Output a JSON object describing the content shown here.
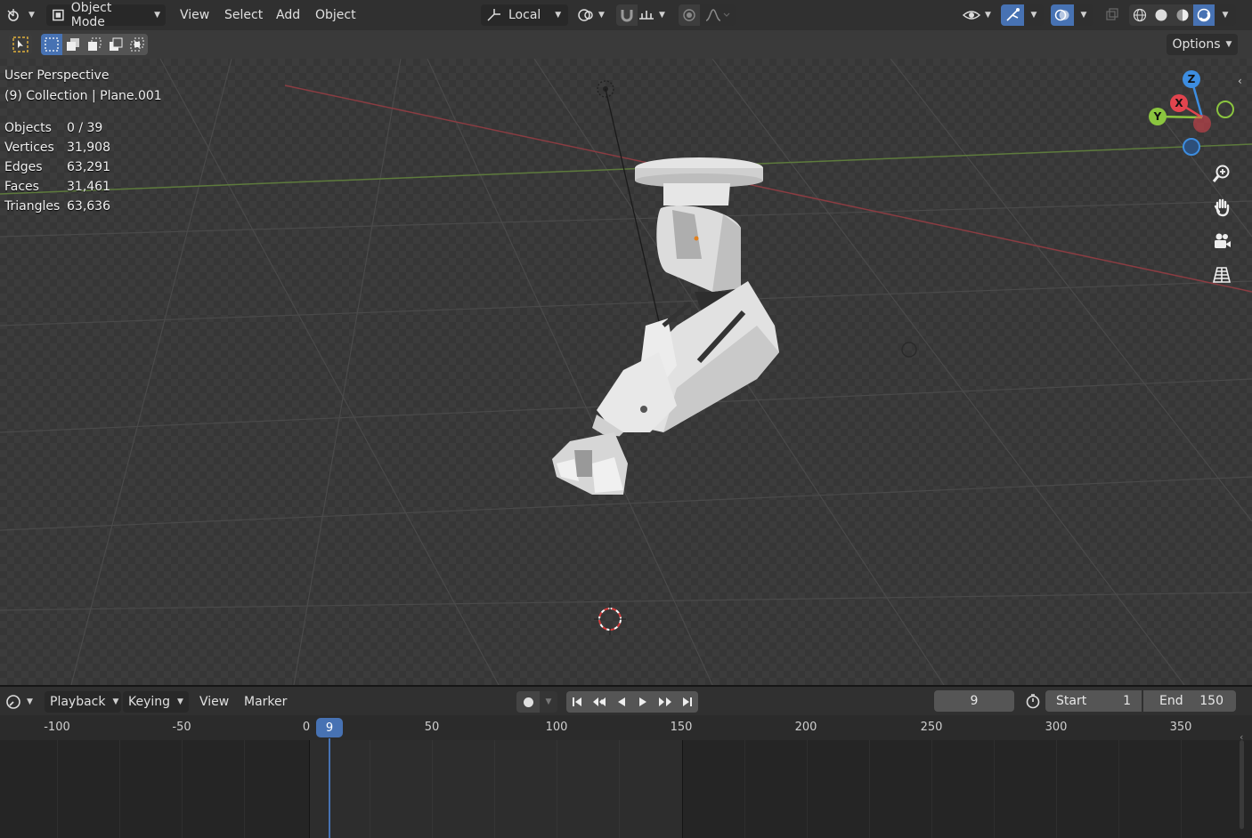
{
  "header": {
    "mode": "Object Mode",
    "menus": [
      "View",
      "Select",
      "Add",
      "Object"
    ],
    "orientation": "Local",
    "options": "Options"
  },
  "viewport": {
    "perspective_label": "User Perspective",
    "collection_label": "(9) Collection | Plane.001",
    "stats": [
      {
        "label": "Objects",
        "value": "0 / 39"
      },
      {
        "label": "Vertices",
        "value": "31,908"
      },
      {
        "label": "Edges",
        "value": "63,291"
      },
      {
        "label": "Faces",
        "value": "31,461"
      },
      {
        "label": "Triangles",
        "value": "63,636"
      }
    ],
    "gizmo": {
      "x": "X",
      "y": "Y",
      "z": "Z"
    }
  },
  "timeline": {
    "menus": [
      "Playback",
      "Keying",
      "View",
      "Marker"
    ],
    "current_frame": "9",
    "start_label": "Start",
    "start_value": "1",
    "end_label": "End",
    "end_value": "150",
    "ruler_ticks": [
      "-100",
      "-50",
      "0",
      "50",
      "100",
      "150",
      "200",
      "250",
      "300",
      "350"
    ],
    "playhead": "9"
  },
  "colors": {
    "accent": "#4772b3",
    "x_axis": "#e2444e",
    "y_axis": "#8bc53f",
    "z_axis": "#3d8de0"
  }
}
